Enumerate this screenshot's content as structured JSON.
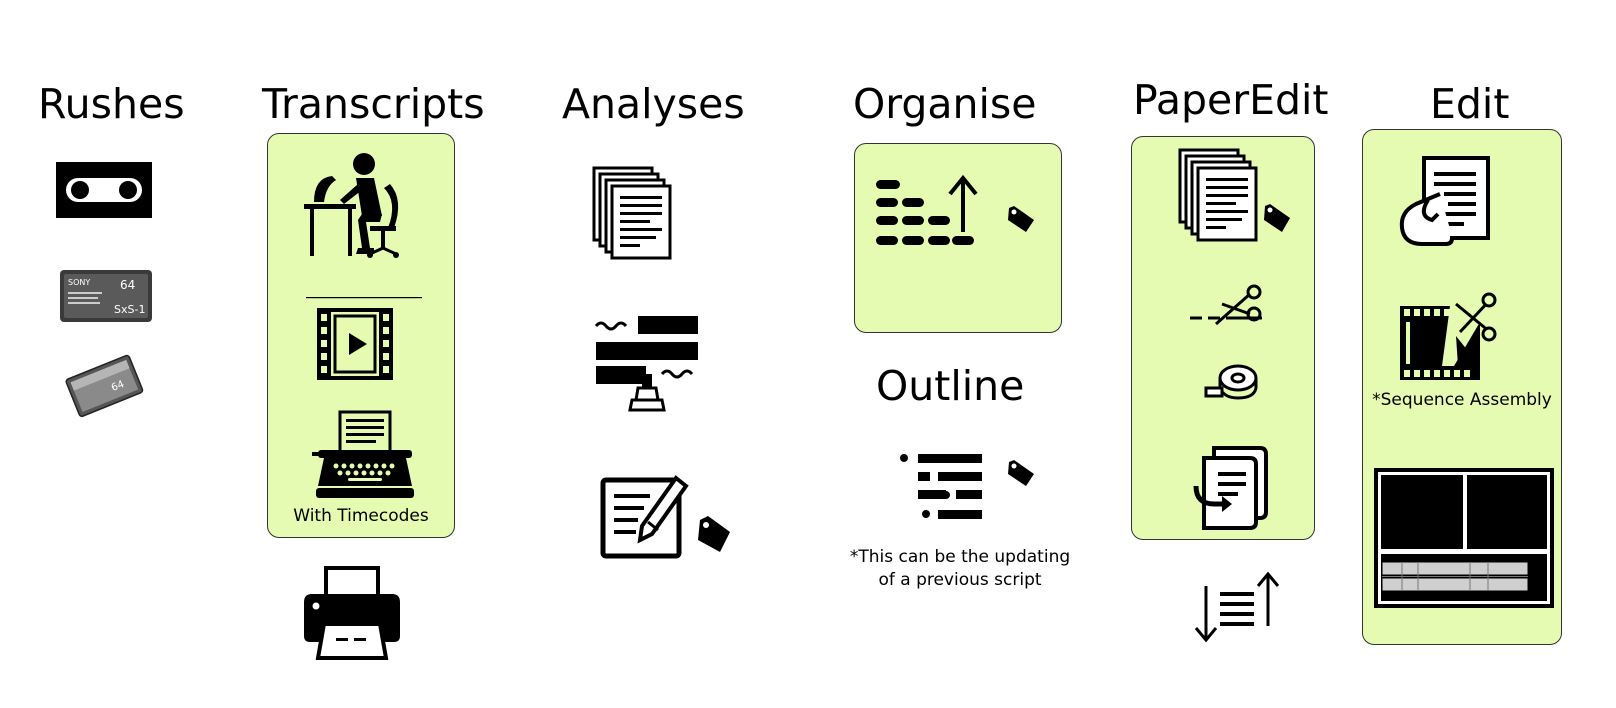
{
  "columns": {
    "rushes": {
      "title": "Rushes"
    },
    "transcripts": {
      "title": "Transcripts",
      "caption": "With Timecodes"
    },
    "analyses": {
      "title": "Analyses"
    },
    "organise": {
      "title": "Organise"
    },
    "outline": {
      "title": "Outline",
      "note_line1": "*This can be the updating",
      "note_line2": "of a previous script"
    },
    "paperedit": {
      "title": "PaperEdit"
    },
    "edit": {
      "title": "Edit",
      "caption": "*Sequence Assembly"
    }
  },
  "media_labels": {
    "sony_brand": "SONY",
    "sony_capacity": "64",
    "sony_model": "SxS-1",
    "cf_capacity": "64"
  },
  "colors": {
    "panel_fill": "#e5fbb1",
    "panel_border": "#333333",
    "icon": "#000000"
  }
}
